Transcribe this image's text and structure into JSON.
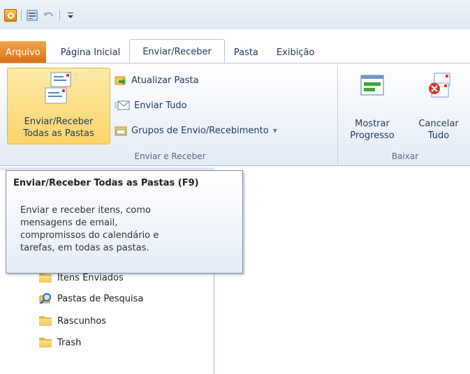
{
  "quick_access": {
    "icons": [
      "outlook-app-icon",
      "send-receive-icon",
      "undo-icon",
      "customize-icon"
    ]
  },
  "tabs": [
    {
      "label": "Arquivo"
    },
    {
      "label": "Página Inicial"
    },
    {
      "label": "Enviar/Receber"
    },
    {
      "label": "Pasta"
    },
    {
      "label": "Exibição"
    }
  ],
  "ribbon": {
    "send_receive_group": {
      "label": "Enviar e Receber",
      "send_receive_all": "Enviar/Receber\nTodas as Pastas",
      "update_folder": "Atualizar Pasta",
      "send_all": "Enviar Tudo",
      "send_receive_groups": "Grupos de Envio/Recebimento"
    },
    "download_group": {
      "label": "Baixar",
      "show_progress": "Mostrar\nProgresso",
      "cancel_all": "Cancelar\nTudo"
    }
  },
  "tooltip": {
    "title": "Enviar/Receber Todas as Pastas (F9)",
    "description": "Enviar e receber itens, como\nmensagens de email,\ncompromissos do calendário e\ntarefas, em todas as pastas."
  },
  "folders": [
    {
      "label": "Itens Enviados",
      "icon": "folder-icon"
    },
    {
      "label": "Pastas de Pesquisa",
      "icon": "search-folder-icon"
    },
    {
      "label": "Rascunhos",
      "icon": "folder-icon"
    },
    {
      "label": "Trash",
      "icon": "folder-icon"
    }
  ],
  "colors": {
    "file_tab": "#dd6b10",
    "ribbon_bg": "#eef3fa",
    "selected_button": "#fbd46b",
    "text": "#1e395b"
  }
}
